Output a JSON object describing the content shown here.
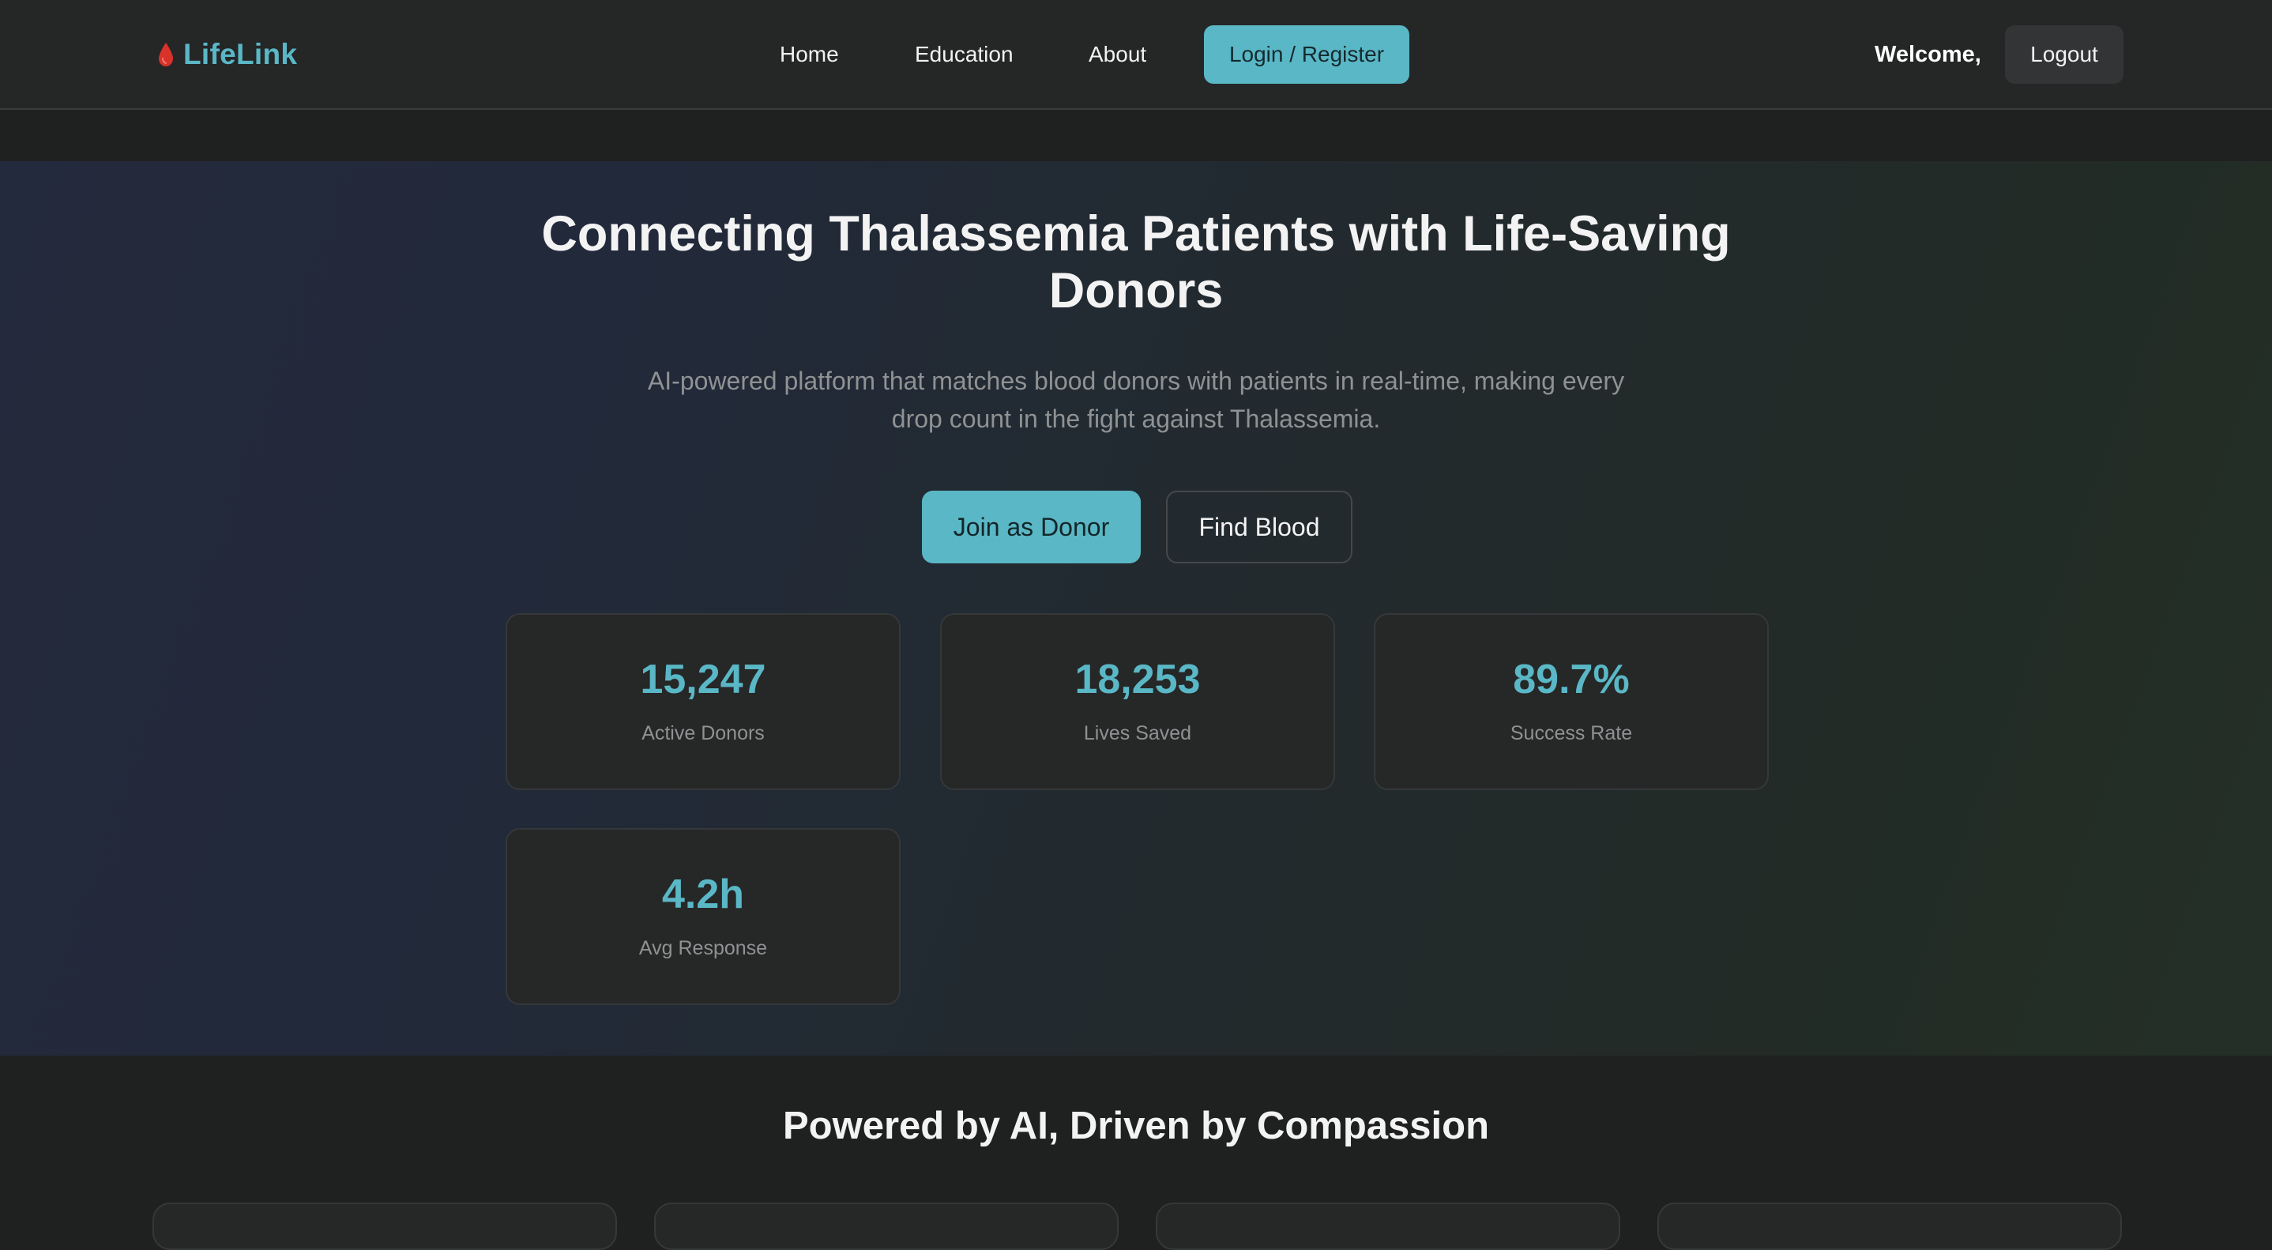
{
  "brand": {
    "name": "LifeLink",
    "icon": "blood-drop-icon",
    "color": "#5ab7c6",
    "icon_color": "#d8322a"
  },
  "nav": {
    "links": [
      "Home",
      "Education",
      "About"
    ],
    "login_label": "Login / Register",
    "welcome_text": "Welcome,",
    "logout_label": "Logout"
  },
  "hero": {
    "title": "Connecting Thalassemia Patients with Life-Saving Donors",
    "subtitle": "AI-powered platform that matches blood donors with patients in real-time, making every drop count in the fight against Thalassemia.",
    "primary_button": "Join as Donor",
    "secondary_button": "Find Blood"
  },
  "stats": [
    {
      "value": "15,247",
      "label": "Active Donors"
    },
    {
      "value": "18,253",
      "label": "Lives Saved"
    },
    {
      "value": "89.7%",
      "label": "Success Rate"
    },
    {
      "value": "4.2h",
      "label": "Avg Response"
    }
  ],
  "features": {
    "title": "Powered by AI, Driven by Compassion"
  },
  "colors": {
    "accent": "#5ab7c6",
    "background": "#1f2020",
    "navbar": "#252626",
    "card": "#262727",
    "muted_text": "#8f9293"
  }
}
